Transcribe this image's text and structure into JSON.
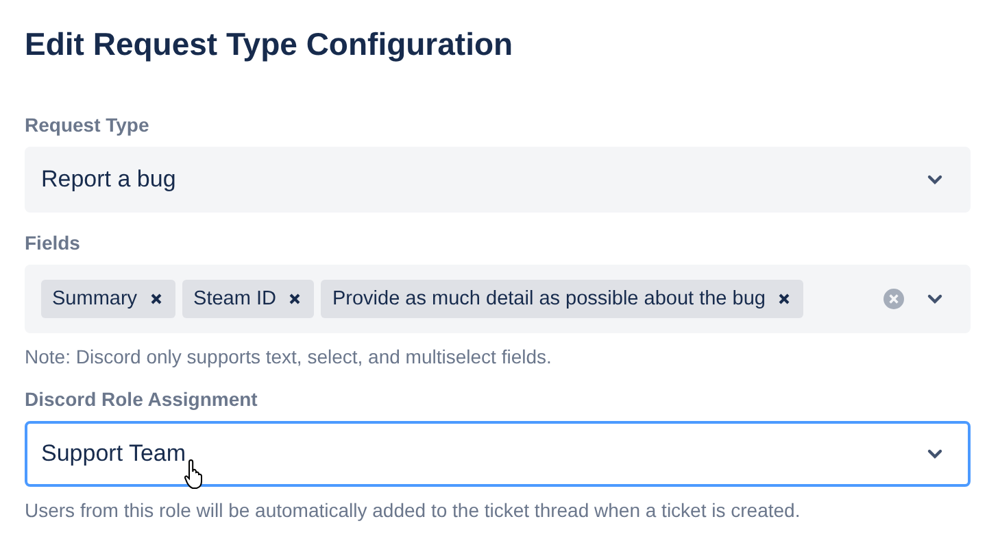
{
  "title": "Edit Request Type Configuration",
  "fields": [
    {
      "kind": "select",
      "label": "Request Type",
      "value": "Report a bug",
      "focused": false
    },
    {
      "kind": "multiselect",
      "label": "Fields",
      "tags": [
        "Summary",
        "Steam ID",
        "Provide as much detail as possible about the bug"
      ],
      "help": "Note: Discord only supports text, select, and multiselect fields.",
      "focused": false
    },
    {
      "kind": "select",
      "label": "Discord Role Assignment",
      "value": "Support Team",
      "focused": true,
      "help": "Users from this role will be automatically added to the ticket thread when a ticket is created."
    }
  ]
}
